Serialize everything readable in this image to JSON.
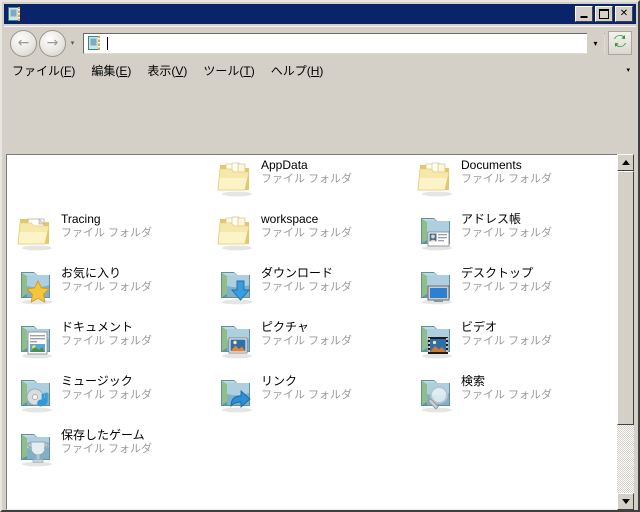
{
  "window": {
    "title": "",
    "title_icon": "folder-window-icon",
    "controls": [
      {
        "name": "minimize-button",
        "glyph": "_"
      },
      {
        "name": "maximize-button",
        "glyph": "□"
      },
      {
        "name": "close-button",
        "glyph": "✕"
      }
    ]
  },
  "navbar": {
    "back_label": "←",
    "forward_label": "→",
    "history_dropdown": "▾",
    "address_value": "",
    "address_placeholder": "",
    "address_icon": "folder-window-icon",
    "address_dropdown": "▾",
    "refresh_icon": "refresh-icon"
  },
  "menubar": {
    "items": [
      {
        "name": "menu-file",
        "pre": "ファイル(",
        "key": "F",
        "post": ")"
      },
      {
        "name": "menu-edit",
        "pre": "編集(",
        "key": "E",
        "post": ")"
      },
      {
        "name": "menu-view",
        "pre": "表示(",
        "key": "V",
        "post": ")"
      },
      {
        "name": "menu-tools",
        "pre": "ツール(",
        "key": "T",
        "post": ")"
      },
      {
        "name": "menu-help",
        "pre": "ヘルプ(",
        "key": "H",
        "post": ")"
      }
    ],
    "overflow": "▾"
  },
  "content": {
    "item_type_label": "ファイル フォルダ",
    "items": [
      {
        "name": "AppData",
        "type": "ファイル フォルダ",
        "icon": "folder-documents-icon",
        "col": 1,
        "row": 0
      },
      {
        "name": "Documents",
        "type": "ファイル フォルダ",
        "icon": "folder-documents-icon",
        "col": 2,
        "row": 0
      },
      {
        "name": "Tracing",
        "type": "ファイル フォルダ",
        "icon": "folder-page-icon",
        "col": 0,
        "row": 1
      },
      {
        "name": "workspace",
        "type": "ファイル フォルダ",
        "icon": "folder-documents-icon",
        "col": 1,
        "row": 1
      },
      {
        "name": "アドレス帳",
        "type": "ファイル フォルダ",
        "icon": "folder-contacts-icon",
        "col": 2,
        "row": 1
      },
      {
        "name": "お気に入り",
        "type": "ファイル フォルダ",
        "icon": "folder-favorites-icon",
        "col": 0,
        "row": 2
      },
      {
        "name": "ダウンロード",
        "type": "ファイル フォルダ",
        "icon": "folder-downloads-icon",
        "col": 1,
        "row": 2
      },
      {
        "name": "デスクトップ",
        "type": "ファイル フォルダ",
        "icon": "folder-desktop-icon",
        "col": 2,
        "row": 2
      },
      {
        "name": "ドキュメント",
        "type": "ファイル フォルダ",
        "icon": "folder-mydocs-icon",
        "col": 0,
        "row": 3
      },
      {
        "name": "ピクチャ",
        "type": "ファイル フォルダ",
        "icon": "folder-pictures-icon",
        "col": 1,
        "row": 3
      },
      {
        "name": "ビデオ",
        "type": "ファイル フォルダ",
        "icon": "folder-videos-icon",
        "col": 2,
        "row": 3
      },
      {
        "name": "ミュージック",
        "type": "ファイル フォルダ",
        "icon": "folder-music-icon",
        "col": 0,
        "row": 4
      },
      {
        "name": "リンク",
        "type": "ファイル フォルダ",
        "icon": "folder-links-icon",
        "col": 1,
        "row": 4
      },
      {
        "name": "検索",
        "type": "ファイル フォルダ",
        "icon": "folder-search-icon",
        "col": 2,
        "row": 4
      },
      {
        "name": "保存したゲーム",
        "type": "ファイル フォルダ",
        "icon": "folder-savedgames-icon",
        "col": 0,
        "row": 5
      }
    ]
  },
  "scrollbar": {
    "up_arrow": "▲",
    "down_arrow": "▼",
    "thumb_top_pct": 0,
    "thumb_height_pct": 79
  },
  "colors": {
    "titlebar": "#0a246a",
    "chrome": "#d4d0c8",
    "content_bg": "#ffffff",
    "type_text": "#9a9a9a",
    "folder_yellow": "#f4e1a0",
    "folder_blue": "#8fb8cf"
  }
}
